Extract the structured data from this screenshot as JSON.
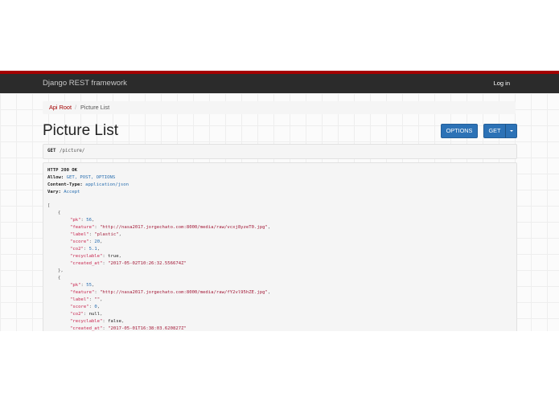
{
  "navbar": {
    "brand": "Django REST framework",
    "login": "Log in"
  },
  "breadcrumb": {
    "root": "Api Root",
    "separator": "/",
    "current": "Picture List"
  },
  "page": {
    "title": "Picture List"
  },
  "buttons": {
    "options": "OPTIONS",
    "get": "GET"
  },
  "request": {
    "method": "GET",
    "path": "/picture/"
  },
  "response": {
    "status": "HTTP 200 OK",
    "headers": [
      {
        "name": "Allow:",
        "value": "GET, POST, OPTIONS"
      },
      {
        "name": "Content-Type:",
        "value": "application/json"
      },
      {
        "name": "Vary:",
        "value": "Accept"
      }
    ],
    "body": {
      "open_bracket": "[",
      "open_brace": "{",
      "close_brace_comma": "},",
      "items": [
        {
          "pk": {
            "key": "\"pk\"",
            "val": "56"
          },
          "feature": {
            "key": "\"feature\"",
            "val": "\"http://nasa2017.jorgechato.com:8000/media/raw/vcxj8yzeT0.jpg\""
          },
          "label": {
            "key": "\"label\"",
            "val": "\"plastic\""
          },
          "score": {
            "key": "\"score\"",
            "val": "20"
          },
          "co2": {
            "key": "\"co2\"",
            "val": "5.1"
          },
          "recyclable": {
            "key": "\"recyclable\"",
            "val": "true"
          },
          "created_at": {
            "key": "\"created_at\"",
            "val": "\"2017-05-02T10:26:32.556674Z\""
          }
        },
        {
          "pk": {
            "key": "\"pk\"",
            "val": "55"
          },
          "feature": {
            "key": "\"feature\"",
            "val": "\"http://nasa2017.jorgechato.com:8000/media/raw/fY2vl95hZE.jpg\""
          },
          "label": {
            "key": "\"label\"",
            "val": "\"\""
          },
          "score": {
            "key": "\"score\"",
            "val": "0"
          },
          "co2": {
            "key": "\"co2\"",
            "val": "null"
          },
          "recyclable": {
            "key": "\"recyclable\"",
            "val": "false"
          },
          "created_at": {
            "key": "\"created_at\"",
            "val": "\"2017-05-01T16:38:03.620827Z\""
          }
        }
      ]
    }
  }
}
